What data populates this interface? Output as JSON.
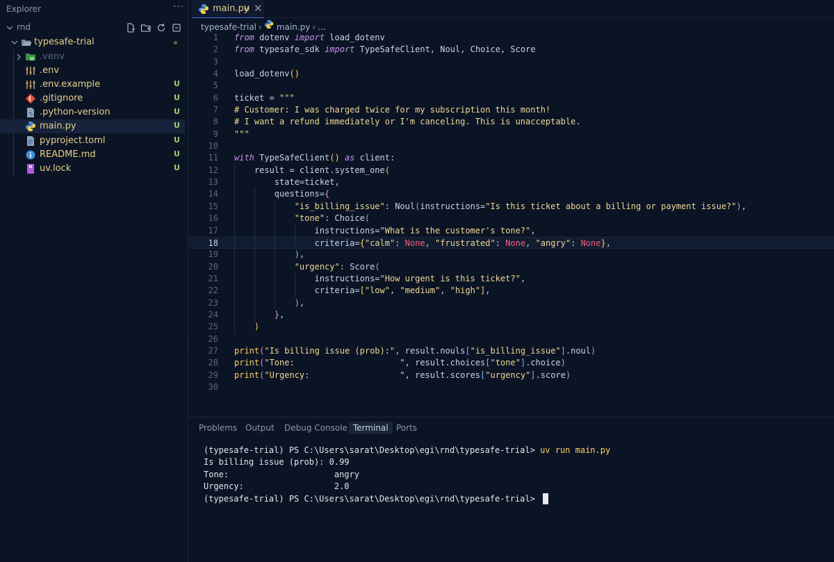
{
  "sidebar": {
    "title": "Explorer",
    "more": "···",
    "root": "rnd",
    "folder": {
      "name": "typesafe-trial"
    },
    "items": [
      {
        "name": ".venv",
        "icon": "folder-venv-icon",
        "status": ""
      },
      {
        "name": ".env",
        "icon": "env-settings-icon",
        "status": ""
      },
      {
        "name": ".env.example",
        "icon": "env-settings-icon",
        "status": "U"
      },
      {
        "name": ".gitignore",
        "icon": "git-icon",
        "status": "U"
      },
      {
        "name": ".python-version",
        "icon": "python-file-icon",
        "status": "U"
      },
      {
        "name": "main.py",
        "icon": "python-icon",
        "status": "U"
      },
      {
        "name": "pyproject.toml",
        "icon": "toml-file-icon",
        "status": "U"
      },
      {
        "name": "README.md",
        "icon": "info-icon",
        "status": "U"
      },
      {
        "name": "uv.lock",
        "icon": "lock-file-icon",
        "status": "U"
      }
    ]
  },
  "editor": {
    "tab": {
      "name": "main.py",
      "modified": "U",
      "close": "✕"
    },
    "breadcrumb": {
      "folder": "typesafe-trial",
      "file": "main.py",
      "symbol": "..."
    },
    "current_line": 18
  },
  "panel": {
    "tabs": [
      "Problems",
      "Output",
      "Debug Console",
      "Terminal",
      "Ports"
    ],
    "active_tab": "Terminal",
    "terminal": {
      "prompt": "(typesafe-trial) PS C:\\Users\\sarat\\Desktop\\egi\\rnd\\typesafe-trial> ",
      "command": "uv run main.py",
      "output": [
        "Is billing issue (prob): 0.99",
        "Tone:                     angry",
        "Urgency:                  2.0"
      ],
      "prompt2": "(typesafe-trial) PS C:\\Users\\sarat\\Desktop\\egi\\rnd\\typesafe-trial> "
    }
  },
  "colors": {
    "background": "#0b1424",
    "keyword": "#c792ea",
    "string": "#f0d896",
    "none": "#ff5b7e",
    "untracked": "#9ccf70",
    "filename": "#e8d08a"
  },
  "code": [
    [
      {
        "t": "from",
        "c": "k"
      },
      {
        "t": " dotenv "
      },
      {
        "t": "import",
        "c": "k"
      },
      {
        "t": " load_dotenv"
      }
    ],
    [
      {
        "t": "from",
        "c": "k"
      },
      {
        "t": " typesafe_sdk "
      },
      {
        "t": "import",
        "c": "k"
      },
      {
        "t": " TypeSafeClient, Noul, Choice, Score"
      }
    ],
    [],
    [
      {
        "t": "load_dotenv"
      },
      {
        "t": "()",
        "c": "p"
      }
    ],
    [],
    [
      {
        "t": "ticket = "
      },
      {
        "t": "\"\"\"",
        "c": "s"
      }
    ],
    [
      {
        "t": "# Customer: I was charged twice for my subscription this month!",
        "c": "s"
      }
    ],
    [
      {
        "t": "# I want a refund immediately or I'm canceling. This is unacceptable.",
        "c": "s"
      }
    ],
    [
      {
        "t": "\"\"\"",
        "c": "s"
      }
    ],
    [],
    [
      {
        "t": "with",
        "c": "k"
      },
      {
        "t": " TypeSafeClient"
      },
      {
        "t": "()",
        "c": "p"
      },
      {
        "t": " "
      },
      {
        "t": "as",
        "c": "k"
      },
      {
        "t": " client:"
      }
    ],
    [
      {
        "t": "    result = client.system_one"
      },
      {
        "t": "(",
        "c": "p"
      }
    ],
    [
      {
        "t": "        state=ticket,"
      }
    ],
    [
      {
        "t": "        questions="
      },
      {
        "t": "{",
        "c": "q"
      }
    ],
    [
      {
        "t": "            "
      },
      {
        "t": "\"is_billing_issue\"",
        "c": "s"
      },
      {
        "t": ": Noul"
      },
      {
        "t": "(",
        "c": "a"
      },
      {
        "t": "instructions="
      },
      {
        "t": "\"Is this ticket about a billing or payment issue?\"",
        "c": "s"
      },
      {
        "t": ")",
        "c": "a"
      },
      {
        "t": ","
      }
    ],
    [
      {
        "t": "            "
      },
      {
        "t": "\"tone\"",
        "c": "s"
      },
      {
        "t": ": Choice"
      },
      {
        "t": "(",
        "c": "a"
      }
    ],
    [
      {
        "t": "                instructions="
      },
      {
        "t": "\"What is the customer's tone?\"",
        "c": "s"
      },
      {
        "t": ","
      }
    ],
    [
      {
        "t": "                criteria="
      },
      {
        "t": "{",
        "c": "p"
      },
      {
        "t": "\"calm\"",
        "c": "s"
      },
      {
        "t": ": "
      },
      {
        "t": "None",
        "c": "n"
      },
      {
        "t": ", "
      },
      {
        "t": "\"frustrated\"",
        "c": "s"
      },
      {
        "t": ": "
      },
      {
        "t": "None",
        "c": "n"
      },
      {
        "t": ", "
      },
      {
        "t": "\"angry\"",
        "c": "s"
      },
      {
        "t": ": "
      },
      {
        "t": "None",
        "c": "n"
      },
      {
        "t": "}",
        "c": "p"
      },
      {
        "t": ","
      }
    ],
    [
      {
        "t": "            "
      },
      {
        "t": ")",
        "c": "a"
      },
      {
        "t": ","
      }
    ],
    [
      {
        "t": "            "
      },
      {
        "t": "\"urgency\"",
        "c": "s"
      },
      {
        "t": ": Score"
      },
      {
        "t": "(",
        "c": "a"
      }
    ],
    [
      {
        "t": "                instructions="
      },
      {
        "t": "\"How urgent is this ticket?\"",
        "c": "s"
      },
      {
        "t": ","
      }
    ],
    [
      {
        "t": "                criteria="
      },
      {
        "t": "[",
        "c": "p"
      },
      {
        "t": "\"low\"",
        "c": "s"
      },
      {
        "t": ", "
      },
      {
        "t": "\"medium\"",
        "c": "s"
      },
      {
        "t": ", "
      },
      {
        "t": "\"high\"",
        "c": "s"
      },
      {
        "t": "]",
        "c": "p"
      },
      {
        "t": ","
      }
    ],
    [
      {
        "t": "            "
      },
      {
        "t": ")",
        "c": "a"
      },
      {
        "t": ","
      }
    ],
    [
      {
        "t": "        "
      },
      {
        "t": "}",
        "c": "q"
      },
      {
        "t": ","
      }
    ],
    [
      {
        "t": "    "
      },
      {
        "t": ")",
        "c": "p"
      }
    ],
    [],
    [
      {
        "t": "print",
        "c": "p"
      },
      {
        "t": "(",
        "c": "q"
      },
      {
        "t": "\"Is billing issue (prob):\"",
        "c": "s"
      },
      {
        "t": ", result.nouls"
      },
      {
        "t": "[",
        "c": "a"
      },
      {
        "t": "\"is_billing_issue\"",
        "c": "s"
      },
      {
        "t": "]",
        "c": "a"
      },
      {
        "t": ".noul"
      },
      {
        "t": ")",
        "c": "q"
      }
    ],
    [
      {
        "t": "print",
        "c": "p"
      },
      {
        "t": "(",
        "c": "q"
      },
      {
        "t": "\"Tone:                     \"",
        "c": "s"
      },
      {
        "t": ", result.choices"
      },
      {
        "t": "[",
        "c": "a"
      },
      {
        "t": "\"tone\"",
        "c": "s"
      },
      {
        "t": "]",
        "c": "a"
      },
      {
        "t": ".choice"
      },
      {
        "t": ")",
        "c": "q"
      }
    ],
    [
      {
        "t": "print",
        "c": "p"
      },
      {
        "t": "(",
        "c": "q"
      },
      {
        "t": "\"Urgency:                  \"",
        "c": "s"
      },
      {
        "t": ", result.scores"
      },
      {
        "t": "[",
        "c": "a"
      },
      {
        "t": "\"urgency\"",
        "c": "s"
      },
      {
        "t": "]",
        "c": "a"
      },
      {
        "t": ".score"
      },
      {
        "t": ")",
        "c": "q"
      }
    ],
    []
  ]
}
